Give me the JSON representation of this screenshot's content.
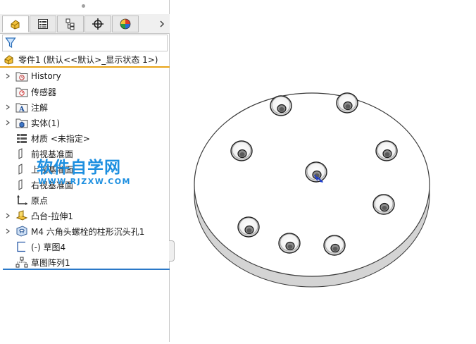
{
  "tabs": [
    {
      "name": "feature-manager",
      "icon": "part-icon"
    },
    {
      "name": "property-manager",
      "icon": "property-list-icon"
    },
    {
      "name": "configuration-manager",
      "icon": "configuration-icon"
    },
    {
      "name": "dimxpert-manager",
      "icon": "crosshair-icon"
    },
    {
      "name": "display-manager",
      "icon": "appearance-ball-icon"
    }
  ],
  "part": {
    "label": "零件1 (默认<<默认>_显示状态 1>)",
    "icon": "part-icon"
  },
  "tree": [
    {
      "label": "History",
      "icon": "history-folder-icon",
      "expandable": true
    },
    {
      "label": "传感器",
      "icon": "sensor-icon",
      "expandable": false
    },
    {
      "label": "注解",
      "icon": "annotation-icon",
      "expandable": true
    },
    {
      "label": "实体(1)",
      "icon": "solid-body-icon",
      "expandable": true
    },
    {
      "label": "材质 <未指定>",
      "icon": "material-icon",
      "expandable": false
    },
    {
      "label": "前视基准面",
      "icon": "plane-icon",
      "expandable": false
    },
    {
      "label": "上视基准面",
      "icon": "plane-icon",
      "expandable": false
    },
    {
      "label": "右视基准面",
      "icon": "plane-icon",
      "expandable": false
    },
    {
      "label": "原点",
      "icon": "origin-icon",
      "expandable": false
    },
    {
      "label": "凸台-拉伸1",
      "icon": "boss-extrude-icon",
      "expandable": true
    },
    {
      "label": "M4 六角头螺栓的柱形沉头孔1",
      "icon": "hole-wizard-icon",
      "expandable": true
    },
    {
      "label": "(-) 草图4",
      "icon": "sketch-icon",
      "expandable": false
    },
    {
      "label": "草图阵列1",
      "icon": "sketch-pattern-icon",
      "expandable": false
    }
  ],
  "watermark": {
    "main": "软件自学网",
    "sub": "WWW.RJZXW.COM"
  },
  "colors": {
    "accent": "#e8a317",
    "rollback": "#2a78c8",
    "watermark": "#1d8fe0"
  }
}
